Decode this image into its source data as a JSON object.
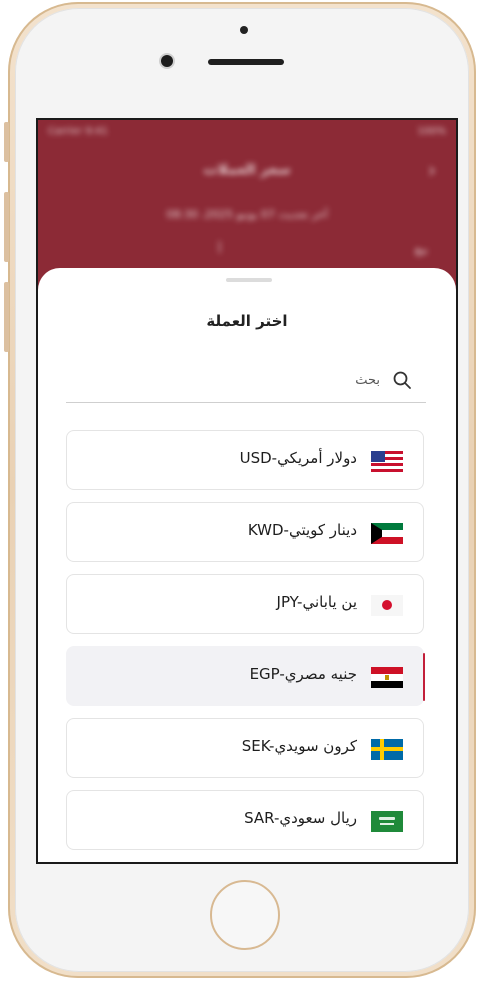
{
  "background_header": {
    "title": "سعر العملات",
    "subtitle": "آخر تحديث 07 يونيو 2025، 08:30",
    "status_left": "Carrier 9:41",
    "status_right": "100%",
    "row_left": "أ",
    "row_right": "بيع"
  },
  "sheet": {
    "title": "اختر العملة",
    "search_placeholder": "بحث"
  },
  "currencies": [
    {
      "label": "USD-دولار أمريكي",
      "icon": "usa-flag-icon",
      "selected": false
    },
    {
      "label": "KWD-دينار كويتي",
      "icon": "kuwait-flag-icon",
      "selected": false
    },
    {
      "label": "JPY-ين ياباني",
      "icon": "japan-flag-icon",
      "selected": false
    },
    {
      "label": "EGP-جنيه مصري",
      "icon": "egypt-flag-icon",
      "selected": true
    },
    {
      "label": "SEK-كرون سويدي",
      "icon": "sweden-flag-icon",
      "selected": false
    },
    {
      "label": "SAR-ريال سعودي",
      "icon": "saudi-flag-icon",
      "selected": false
    }
  ],
  "colors": {
    "header_bg": "#8c2a36",
    "selected_accent": "#c21f3a",
    "selected_bg": "#f2f2f5",
    "phone_frame": "#e9d1b4"
  }
}
